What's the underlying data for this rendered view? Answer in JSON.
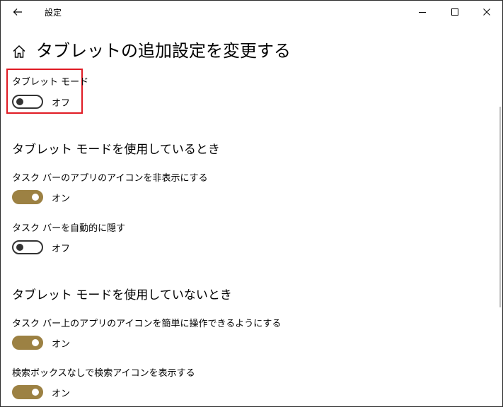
{
  "window": {
    "app_title": "設定"
  },
  "page": {
    "title": "タブレットの追加設定を変更する"
  },
  "tablet_mode": {
    "label": "タブレット モード",
    "state": "オフ",
    "on": false
  },
  "section_when_on": {
    "heading": "タブレット モードを使用しているとき",
    "settings": [
      {
        "label": "タスク バーのアプリのアイコンを非表示にする",
        "state": "オン",
        "on": true
      },
      {
        "label": "タスク バーを自動的に隠す",
        "state": "オフ",
        "on": false
      }
    ]
  },
  "section_when_off": {
    "heading": "タブレット モードを使用していないとき",
    "settings": [
      {
        "label": "タスク バー上のアプリのアイコンを簡単に操作できるようにする",
        "state": "オン",
        "on": true
      },
      {
        "label": "検索ボックスなしで検索アイコンを表示する",
        "state": "オン",
        "on": true
      }
    ]
  },
  "colors": {
    "accent": "#9c8143",
    "highlight": "#e01b24",
    "toggle_off": "#333333"
  },
  "icons": {
    "back": "back-arrow-icon",
    "home": "home-icon",
    "minimize": "minimize-icon",
    "maximize": "maximize-icon",
    "close": "close-icon"
  }
}
